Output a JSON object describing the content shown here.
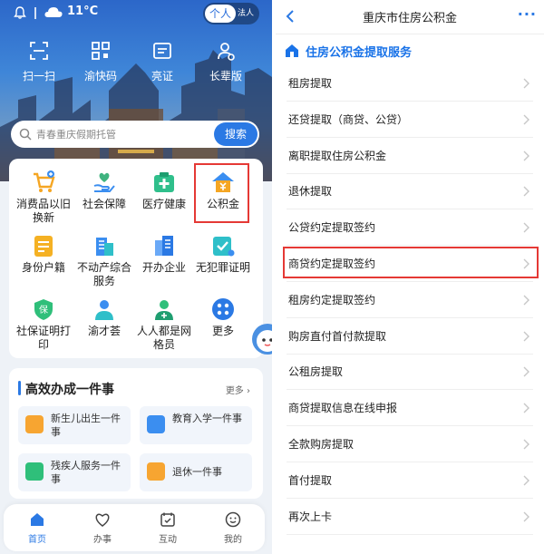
{
  "left": {
    "status": {
      "temperature": "11°C",
      "toggle_on": "个人",
      "toggle_off": "法人"
    },
    "quick_actions": [
      "扫一扫",
      "渝快码",
      "亮证",
      "长辈版"
    ],
    "search": {
      "placeholder": "青春重庆假期托管",
      "button": "搜索"
    },
    "grid": [
      {
        "label": "消费品以旧换新",
        "icon": "shopping-cart-icon"
      },
      {
        "label": "社会保障",
        "icon": "heart-hand-icon"
      },
      {
        "label": "医疗健康",
        "icon": "medical-cross-icon"
      },
      {
        "label": "公积金",
        "icon": "house-fund-icon"
      },
      {
        "label": "身份户籍",
        "icon": "id-card-icon"
      },
      {
        "label": "不动产综合服务",
        "icon": "building-icon"
      },
      {
        "label": "开办企业",
        "icon": "office-building-icon"
      },
      {
        "label": "无犯罪证明",
        "icon": "certificate-check-icon"
      },
      {
        "label": "社保证明打印",
        "icon": "shield-icon"
      },
      {
        "label": "渝才荟",
        "icon": "person-icon"
      },
      {
        "label": "人人都是网格员",
        "icon": "grid-person-icon"
      },
      {
        "label": "更多",
        "icon": "more-dots-icon"
      }
    ],
    "efficient": {
      "title": "高效办成一件事",
      "more": "更多",
      "items": [
        "新生儿出生一件事",
        "教育入学一件事",
        "残疾人服务一件事",
        "退休一件事"
      ]
    },
    "tabs": [
      "首页",
      "办事",
      "互动",
      "我的"
    ]
  },
  "right": {
    "title": "重庆市住房公积金",
    "section_title": "住房公积金提取服务",
    "items": [
      "租房提取",
      "还贷提取（商贷、公贷）",
      "离职提取住房公积金",
      "退休提取",
      "公贷约定提取签约",
      "商贷约定提取签约",
      "租房约定提取签约",
      "购房直付首付款提取",
      "公租房提取",
      "商贷提取信息在线申报",
      "全款购房提取",
      "首付提取",
      "再次上卡"
    ]
  },
  "colors": {
    "accent": "#2b79e4",
    "highlight": "#e53935"
  }
}
